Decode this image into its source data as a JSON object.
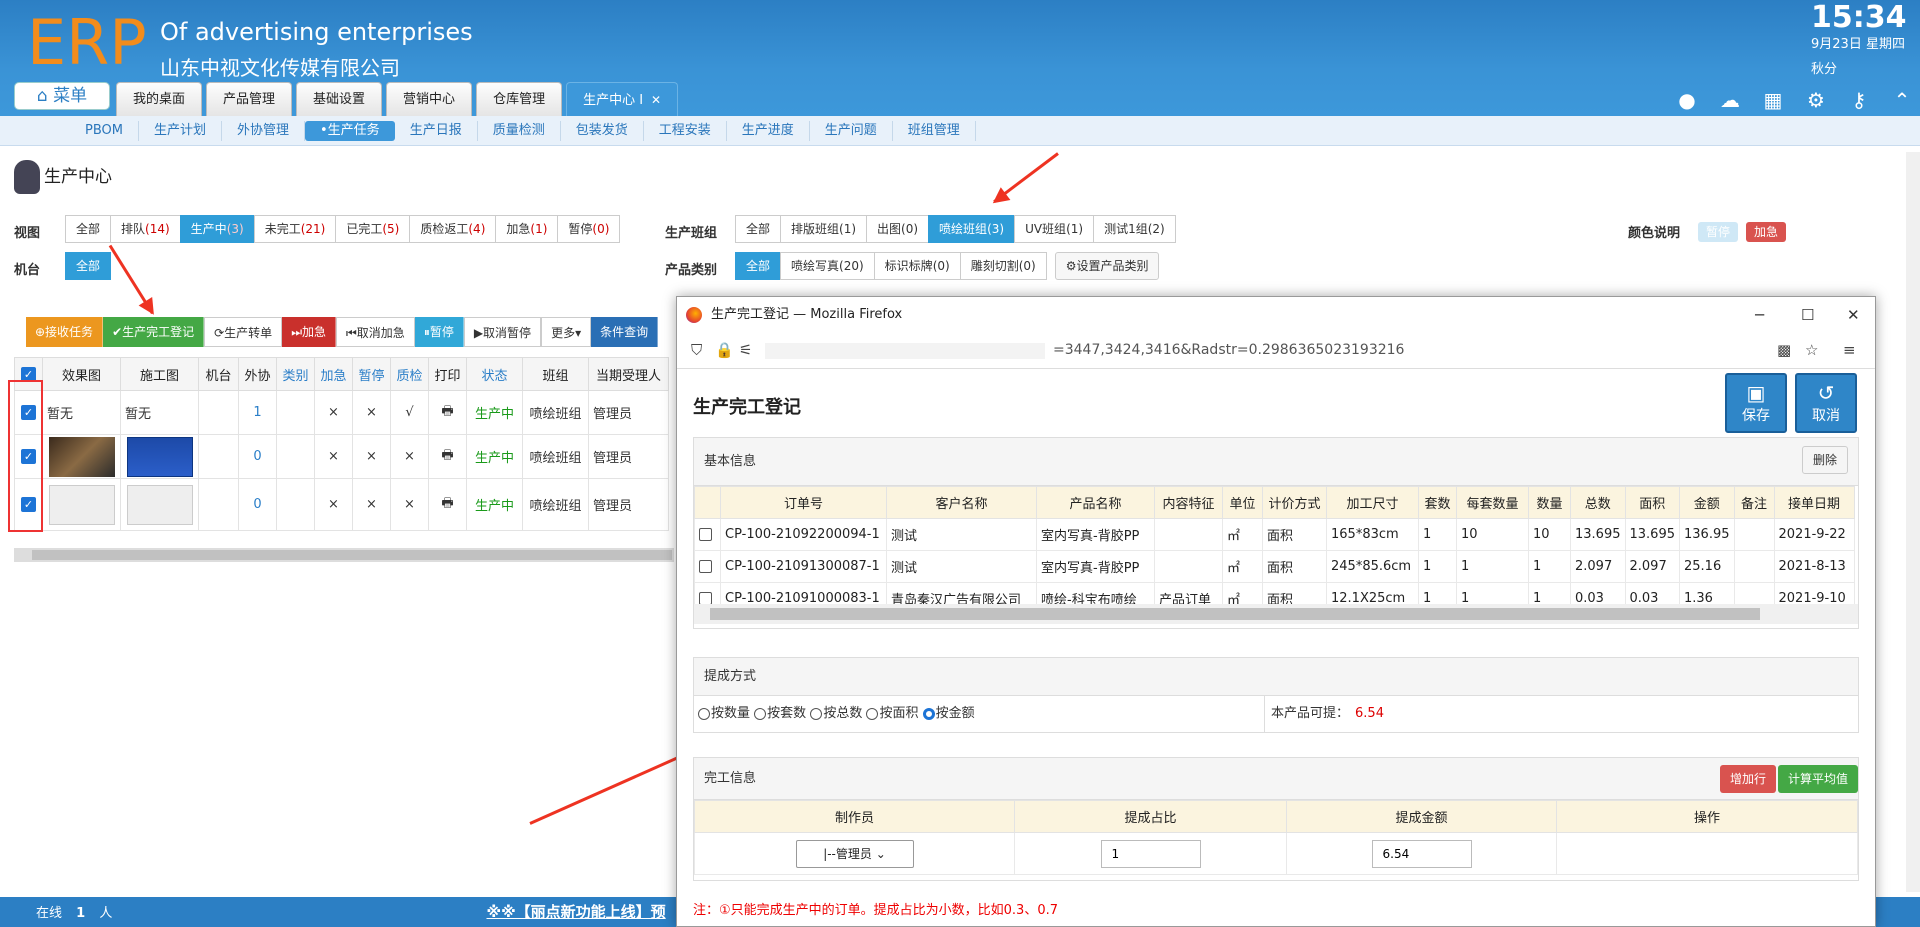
{
  "header": {
    "logo": "ERP",
    "company_en": "Of advertising enterprises",
    "company_cn": "山东中视文化传媒有限公司",
    "time": "15:34",
    "date": "9月23日 星期四",
    "season": "秋分",
    "menu_label": "菜单"
  },
  "tabs": [
    {
      "label": "我的桌面"
    },
    {
      "label": "产品管理"
    },
    {
      "label": "基础设置"
    },
    {
      "label": "营销中心"
    },
    {
      "label": "仓库管理"
    },
    {
      "label": "生产中心 I"
    }
  ],
  "subnav": [
    "PBOM",
    "生产计划",
    "外协管理",
    "•生产任务",
    "生产日报",
    "质量检测",
    "包装发货",
    "工程安装",
    "生产进度",
    "生产问题",
    "班组管理"
  ],
  "page_title": "生产中心",
  "filters": {
    "view_label": "视图",
    "machine_label": "机台",
    "group_label": "生产班组",
    "category_label": "产品类别",
    "color_label": "颜色说明",
    "view": [
      {
        "t": "全部",
        "c": ""
      },
      {
        "t": "排队",
        "c": "(14)"
      },
      {
        "t": "生产中",
        "c": "(3)"
      },
      {
        "t": "未完工",
        "c": "(21)"
      },
      {
        "t": "已完工",
        "c": "(5)"
      },
      {
        "t": "质检返工",
        "c": "(4)"
      },
      {
        "t": "加急",
        "c": "(1)"
      },
      {
        "t": "暂停",
        "c": "(0)"
      }
    ],
    "machine": [
      "全部"
    ],
    "groups": [
      {
        "t": "全部",
        "c": ""
      },
      {
        "t": "排版班组",
        "c": "(1)"
      },
      {
        "t": "出图",
        "c": "(0)"
      },
      {
        "t": "喷绘班组",
        "c": "(3)"
      },
      {
        "t": "UV班组",
        "c": "(1)"
      },
      {
        "t": "测试1组",
        "c": "(2)"
      }
    ],
    "categories": [
      {
        "t": "全部",
        "c": ""
      },
      {
        "t": "喷绘写真",
        "c": "(20)"
      },
      {
        "t": "标识标牌",
        "c": "(0)"
      },
      {
        "t": "雕刻切割",
        "c": "(0)"
      }
    ],
    "set_category": "⚙设置产品类别",
    "legend": [
      {
        "t": "暂停",
        "color": "#cfe8f6"
      },
      {
        "t": "加急",
        "color": "#d9534f"
      }
    ]
  },
  "toolbar": [
    {
      "t": "⊕接收任务",
      "color": "#ec971f"
    },
    {
      "t": "✔生产完工登记",
      "color": "#44a845"
    },
    {
      "t": "⟳生产转单",
      "color": "#ffffff"
    },
    {
      "t": "⏭加急",
      "color": "#c9302c"
    },
    {
      "t": "⏮取消加急",
      "color": "#ffffff"
    },
    {
      "t": "⏸暂停",
      "color": "#31a8d8"
    },
    {
      "t": "▶取消暂停",
      "color": "#ffffff"
    },
    {
      "t": "更多▾",
      "color": "#ffffff"
    },
    {
      "t": "条件查询",
      "color": "#2a6fb5"
    }
  ],
  "main_table": {
    "headers": [
      "效果图",
      "施工图",
      "机台",
      "外协",
      "类别",
      "加急",
      "暂停",
      "质检",
      "打印",
      "状态",
      "班组",
      "当期受理人"
    ],
    "rows": [
      {
        "e": "暂无",
        "s": "暂无",
        "w": "1",
        "u": "×",
        "p": "×",
        "q": "√",
        "st": "生产中",
        "g": "喷绘班组",
        "m": "管理员"
      },
      {
        "e": "",
        "s": "",
        "w": "0",
        "u": "×",
        "p": "×",
        "q": "×",
        "st": "生产中",
        "g": "喷绘班组",
        "m": "管理员"
      },
      {
        "e": "",
        "s": "",
        "w": "0",
        "u": "×",
        "p": "×",
        "q": "×",
        "st": "生产中",
        "g": "喷绘班组",
        "m": "管理员"
      }
    ]
  },
  "statusbar": {
    "online_label": "在线",
    "online_count": "1",
    "online_unit": "人",
    "marquee": "※※【丽点新功能上线】预"
  },
  "popup": {
    "window_title": "生产完工登记 — Mozilla Firefox",
    "url": "=3447,3424,3416&Radstr=0.2986365023193216",
    "form_title": "生产完工登记",
    "save_label": "保存",
    "cancel_label": "取消",
    "basic_label": "基本信息",
    "delete_label": "删除",
    "headers": [
      "订单号",
      "客户名称",
      "产品名称",
      "内容特征",
      "单位",
      "计价方式",
      "加工尺寸",
      "套数",
      "每套数量",
      "数量",
      "总数",
      "面积",
      "金额",
      "备注",
      "接单日期"
    ],
    "rows": [
      [
        "CP-100-21092200094-1",
        "测试",
        "室内写真-背胶PP",
        "",
        "㎡",
        "面积",
        "165*83cm",
        "1",
        "10",
        "10",
        "13.695",
        "13.695",
        "136.95",
        "",
        "2021-9-22"
      ],
      [
        "CP-100-21091300087-1",
        "测试",
        "室内写真-背胶PP",
        "",
        "㎡",
        "面积",
        "245*85.6cm",
        "1",
        "1",
        "1",
        "2.097",
        "2.097",
        "25.16",
        "",
        "2021-8-13"
      ],
      [
        "CP-100-21091000083-1",
        "青岛秦汉广告有限公司",
        "喷绘-科宝布喷绘",
        "产品订单",
        "㎡",
        "面积",
        "12.1X25cm",
        "1",
        "1",
        "1",
        "0.03",
        "0.03",
        "1.36",
        "",
        "2021-9-10"
      ]
    ],
    "commission_label": "提成方式",
    "radio_options": [
      "按数量",
      "按套数",
      "按总数",
      "按面积",
      "按金额"
    ],
    "radio_selected": 4,
    "available_label": "本产品可提：",
    "available_value": "6.54",
    "finish_label": "完工信息",
    "add_row": "增加行",
    "avg": "计算平均值",
    "finish_headers": [
      "制作员",
      "提成占比",
      "提成金额",
      "操作"
    ],
    "worker": "|--管理员",
    "ratio": "1",
    "amount": "6.54",
    "note": "注：①只能完成生产中的订单。提成占比为小数，比如0.3、0.7"
  }
}
